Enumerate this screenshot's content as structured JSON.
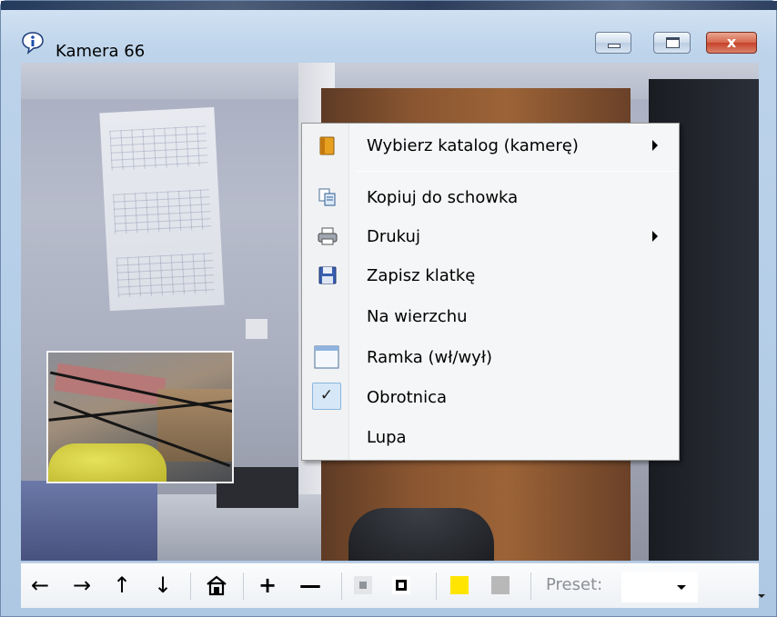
{
  "window": {
    "title": "Kamera 66",
    "title_icon": "info-bubble-icon",
    "caption_buttons": {
      "minimize_icon": "minimize-icon",
      "maximize_icon": "maximize-icon",
      "close_icon": "close-icon",
      "close_glyph": "x"
    }
  },
  "context_menu": {
    "items": [
      {
        "label": "Wybierz katalog (kamerę)",
        "icon": "folder-icon",
        "has_submenu": true
      },
      {
        "label": "Kopiuj do schowka",
        "icon": "copy-icon",
        "has_submenu": false
      },
      {
        "label": "Drukuj",
        "icon": "printer-icon",
        "has_submenu": true
      },
      {
        "label": "Zapisz klatkę",
        "icon": "floppy-disk-icon",
        "has_submenu": false
      },
      {
        "label": "Na wierzchu",
        "icon": "",
        "has_submenu": false
      },
      {
        "label": "Ramka (wł/wył)",
        "icon": "window-frame-icon",
        "has_submenu": false
      },
      {
        "label": "Obrotnica",
        "icon": "checkmark-icon",
        "checked": true,
        "has_submenu": false
      },
      {
        "label": "Lupa",
        "icon": "",
        "has_submenu": false
      }
    ]
  },
  "toolbar": {
    "left_arrow": "←",
    "right_arrow": "→",
    "up_arrow": "↑",
    "down_arrow": "↓",
    "home_icon": "home-icon",
    "zoom_in": "+",
    "zoom_out": "—",
    "preset_label": "Preset:",
    "preset_value": "",
    "colors": {
      "yellow_swatch": "#ffe500",
      "gray_swatch": "#b8b8b8"
    }
  }
}
